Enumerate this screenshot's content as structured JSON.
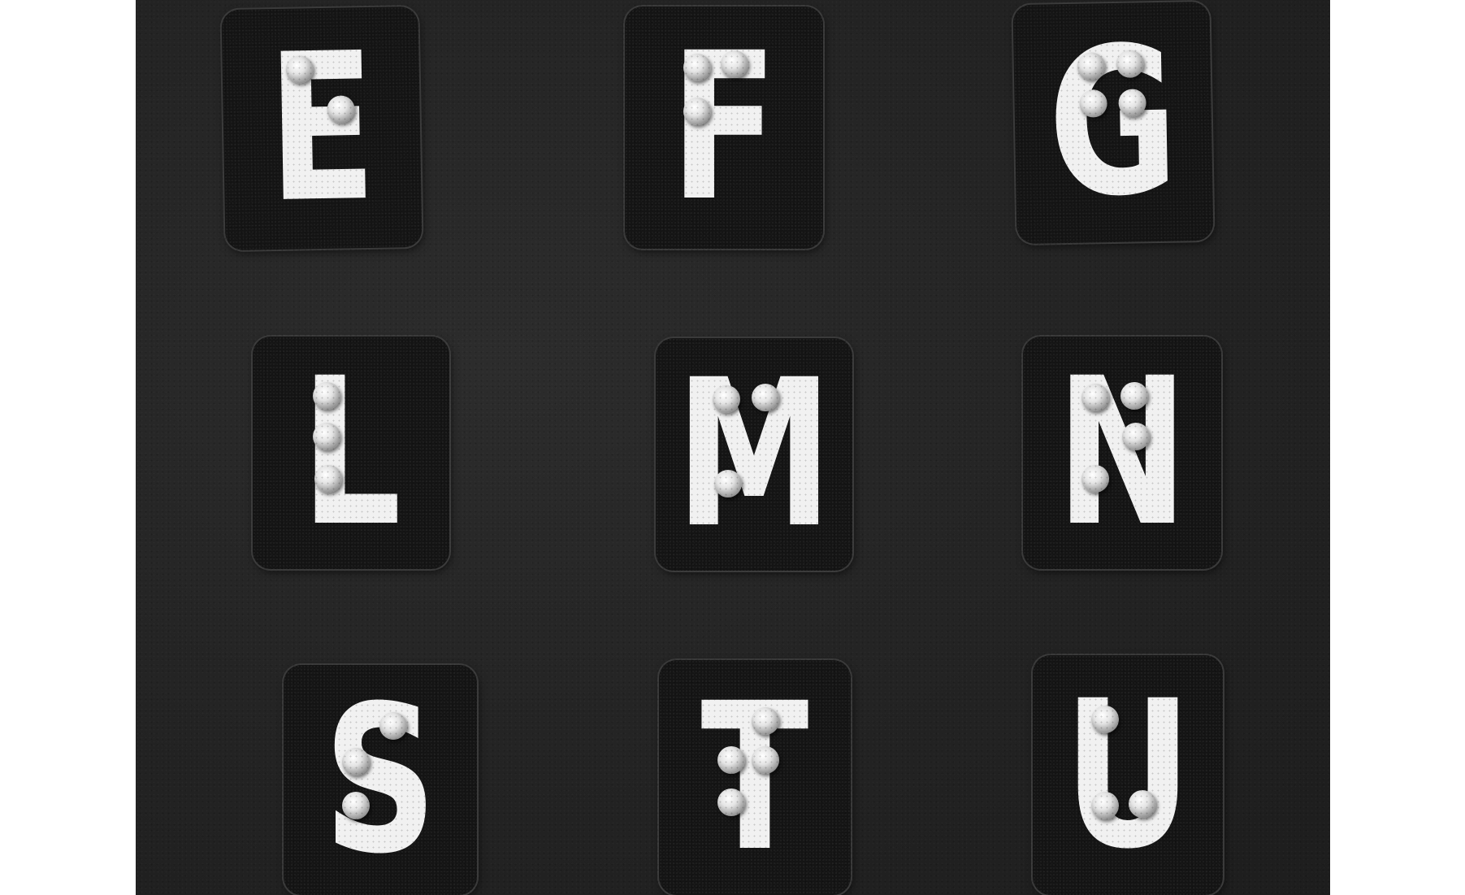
{
  "image": {
    "tiles": [
      {
        "id": "e",
        "letter": "E"
      },
      {
        "id": "f",
        "letter": "F"
      },
      {
        "id": "g",
        "letter": "G"
      },
      {
        "id": "l",
        "letter": "L"
      },
      {
        "id": "m",
        "letter": "M"
      },
      {
        "id": "n",
        "letter": "N"
      },
      {
        "id": "s",
        "letter": "S"
      },
      {
        "id": "t",
        "letter": "T"
      },
      {
        "id": "u",
        "letter": "U"
      }
    ]
  },
  "colors": {
    "background": "#ffffff",
    "board": "#232323",
    "tile": "#141414",
    "letter": "#f1f1f1"
  }
}
